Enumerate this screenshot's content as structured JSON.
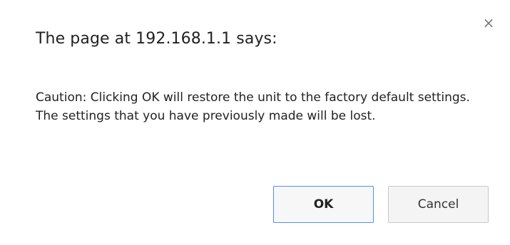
{
  "dialog": {
    "title": "The page at 192.168.1.1 says:",
    "close_icon": "×",
    "message": "Caution: Clicking OK will restore the unit to the factory default settings. The settings that you have previously made will be lost.",
    "ok_label": "OK",
    "cancel_label": "Cancel"
  },
  "colors": {
    "background": "#ffffff",
    "ok_border": "#4d90fe",
    "button_border": "#c8c8c8",
    "button_bg": "#f4f4f4"
  },
  "icons": {
    "close": "close-icon"
  }
}
